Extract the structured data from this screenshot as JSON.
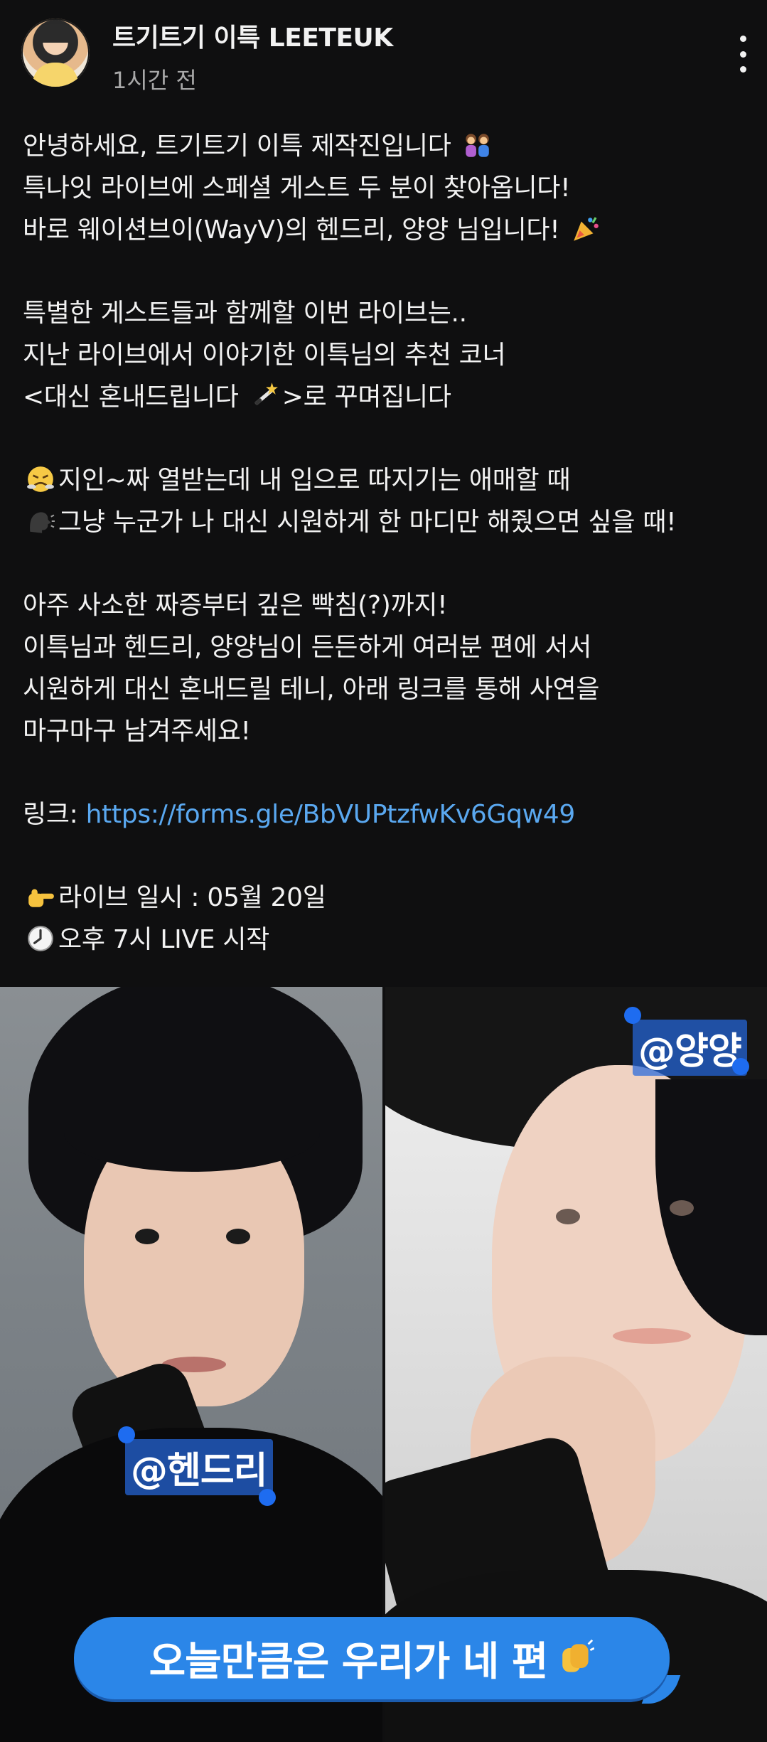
{
  "header": {
    "title": "트기트기 이특 LEETEUK",
    "time": "1시간 전",
    "more_icon": "more-vertical-icon"
  },
  "post": {
    "p1": [
      "안녕하세요, 트기트기 이특 제작진입니다",
      "특나잇 라이브에 스페셜 게스트 두 분이 찾아옵니다!",
      "바로 웨이션브이(WayV)의 헨드리, 양양 님입니다!"
    ],
    "p2": [
      "특별한 게스트들과 함께할 이번 라이브는..",
      "지난 라이브에서 이야기한 이특님의 추천 코너",
      " <대신 혼내드립니다",
      ">로 꾸며집니다"
    ],
    "p3": [
      "지인~짜 열받는데 내 입으로 따지기는 애매할 때",
      "그냥 누군가 나 대신 시원하게 한 마디만 해줬으면 싶을 때!"
    ],
    "p4": [
      "아주 사소한 짜증부터 깊은 빡침(?)까지!",
      "이특님과 헨드리, 양양님이 든든하게 여러분 편에 서서",
      "시원하게 대신 혼내드릴 테니, 아래 링크를 통해 사연을",
      "마구마구 남겨주세요!"
    ],
    "link_label": "링크: ",
    "link_url": "https://forms.gle/BbVUPtzfwKv6Gqw49",
    "schedule_date": "라이브 일시 : 05월 20일",
    "schedule_time": "오후 7시 LIVE 시작"
  },
  "images": {
    "left_tag": "@헨드리",
    "right_tag": "@양양",
    "bubble_text": "오늘만큼은 우리가 네 편"
  },
  "colors": {
    "background": "#0f0f10",
    "link": "#5aa8f0",
    "bubble": "#2b86e8",
    "tag_highlight": "#2668dc"
  }
}
